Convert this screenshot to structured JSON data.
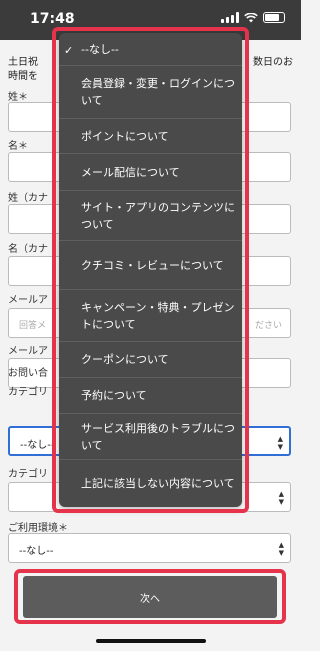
{
  "status": {
    "time": "17:48"
  },
  "form": {
    "notice_left": "土日祝",
    "notice_left2": "時間を",
    "notice_right": "数日のお",
    "labels": {
      "sei": "姓＊",
      "mei": "名＊",
      "sei_kana": "姓（カナ",
      "mei_kana": "名（カナ",
      "email": "メールア",
      "email_confirm": "メールア",
      "inquiry": "お問い合",
      "category1": "カテゴリ",
      "category2": "カテゴリ",
      "environment": "ご利用環境＊"
    },
    "email_placeholder_left": "回答メ",
    "email_placeholder_right": "ださい",
    "category1_value": "--なし--",
    "environment_value": "--なし--",
    "next_button": "次へ"
  },
  "dropdown": {
    "items": [
      {
        "label": "--なし--",
        "selected": true
      },
      {
        "label": "会員登録・変更・ログインについて"
      },
      {
        "label": "ポイントについて"
      },
      {
        "label": "メール配信について"
      },
      {
        "label": "サイト・アプリのコンテンツについて"
      },
      {
        "label": "クチコミ・レビューについて"
      },
      {
        "label": "キャンペーン・特典・プレゼントについて"
      },
      {
        "label": "クーポンについて"
      },
      {
        "label": "予約について"
      },
      {
        "label": "サービス利用後のトラブルについて"
      },
      {
        "label": "上記に該当しない内容について"
      }
    ]
  },
  "colors": {
    "highlight": "#e5334b",
    "dropdown_bg": "#4a4a4a",
    "button_bg": "#5c5c5c"
  }
}
